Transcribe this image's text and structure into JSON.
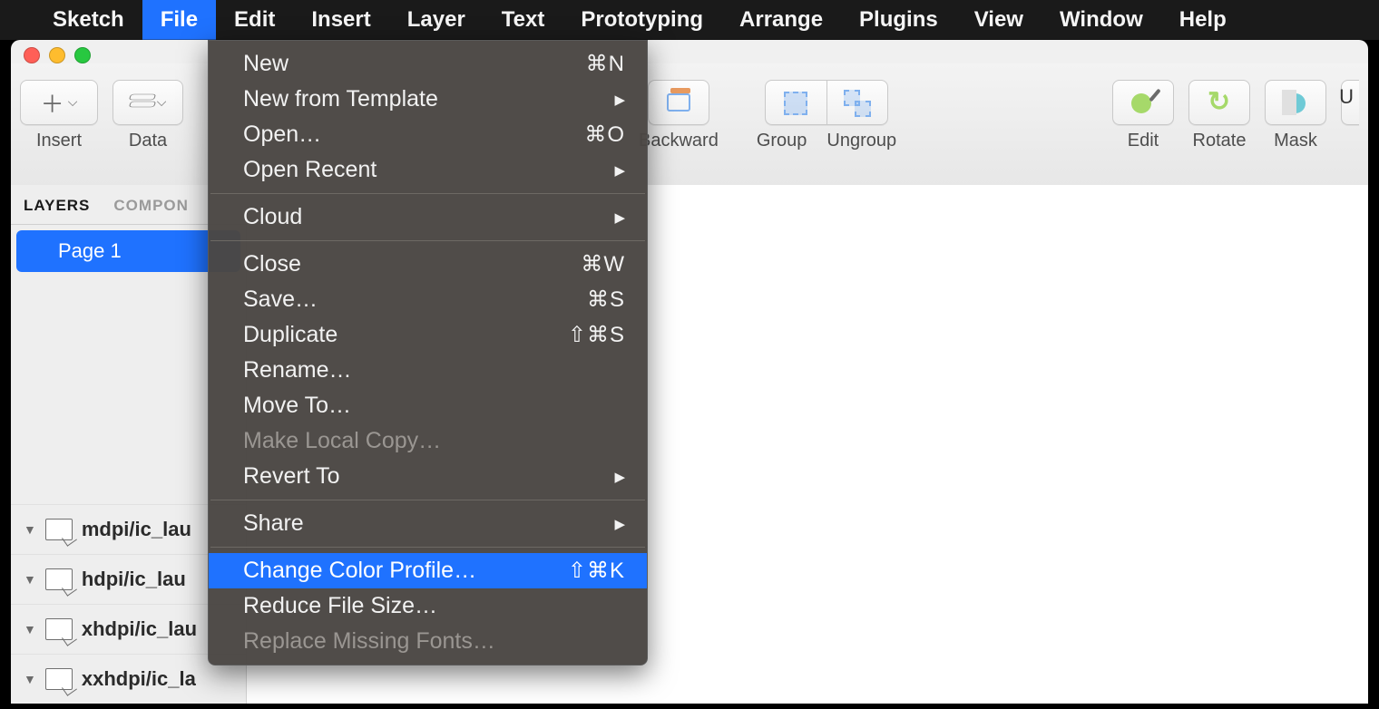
{
  "menubar": {
    "app": "Sketch",
    "items": [
      "File",
      "Edit",
      "Insert",
      "Layer",
      "Text",
      "Prototyping",
      "Arrange",
      "Plugins",
      "View",
      "Window",
      "Help"
    ],
    "active": "File"
  },
  "window": {
    "title_right": "U"
  },
  "toolbar": {
    "insert": "Insert",
    "data": "Data",
    "backward": "Backward",
    "group": "Group",
    "ungroup": "Ungroup",
    "edit": "Edit",
    "rotate": "Rotate",
    "mask": "Mask"
  },
  "sidebar": {
    "tabs": {
      "layers": "LAYERS",
      "components": "COMPON"
    },
    "page": "Page 1",
    "layers": [
      "mdpi/ic_lau",
      "hdpi/ic_lau",
      "xhdpi/ic_lau",
      "xxhdpi/ic_la"
    ]
  },
  "file_menu": {
    "groups": [
      [
        {
          "label": "New",
          "shortcut": "⌘N"
        },
        {
          "label": "New from Template",
          "submenu": true
        },
        {
          "label": "Open…",
          "shortcut": "⌘O"
        },
        {
          "label": "Open Recent",
          "submenu": true
        }
      ],
      [
        {
          "label": "Cloud",
          "submenu": true
        }
      ],
      [
        {
          "label": "Close",
          "shortcut": "⌘W"
        },
        {
          "label": "Save…",
          "shortcut": "⌘S"
        },
        {
          "label": "Duplicate",
          "shortcut": "⇧⌘S"
        },
        {
          "label": "Rename…"
        },
        {
          "label": "Move To…"
        },
        {
          "label": "Make Local Copy…",
          "disabled": true
        },
        {
          "label": "Revert To",
          "submenu": true
        }
      ],
      [
        {
          "label": "Share",
          "submenu": true
        }
      ],
      [
        {
          "label": "Change Color Profile…",
          "shortcut": "⇧⌘K",
          "highlight": true
        },
        {
          "label": "Reduce File Size…"
        },
        {
          "label": "Replace Missing Fonts…",
          "disabled": true
        }
      ]
    ]
  }
}
